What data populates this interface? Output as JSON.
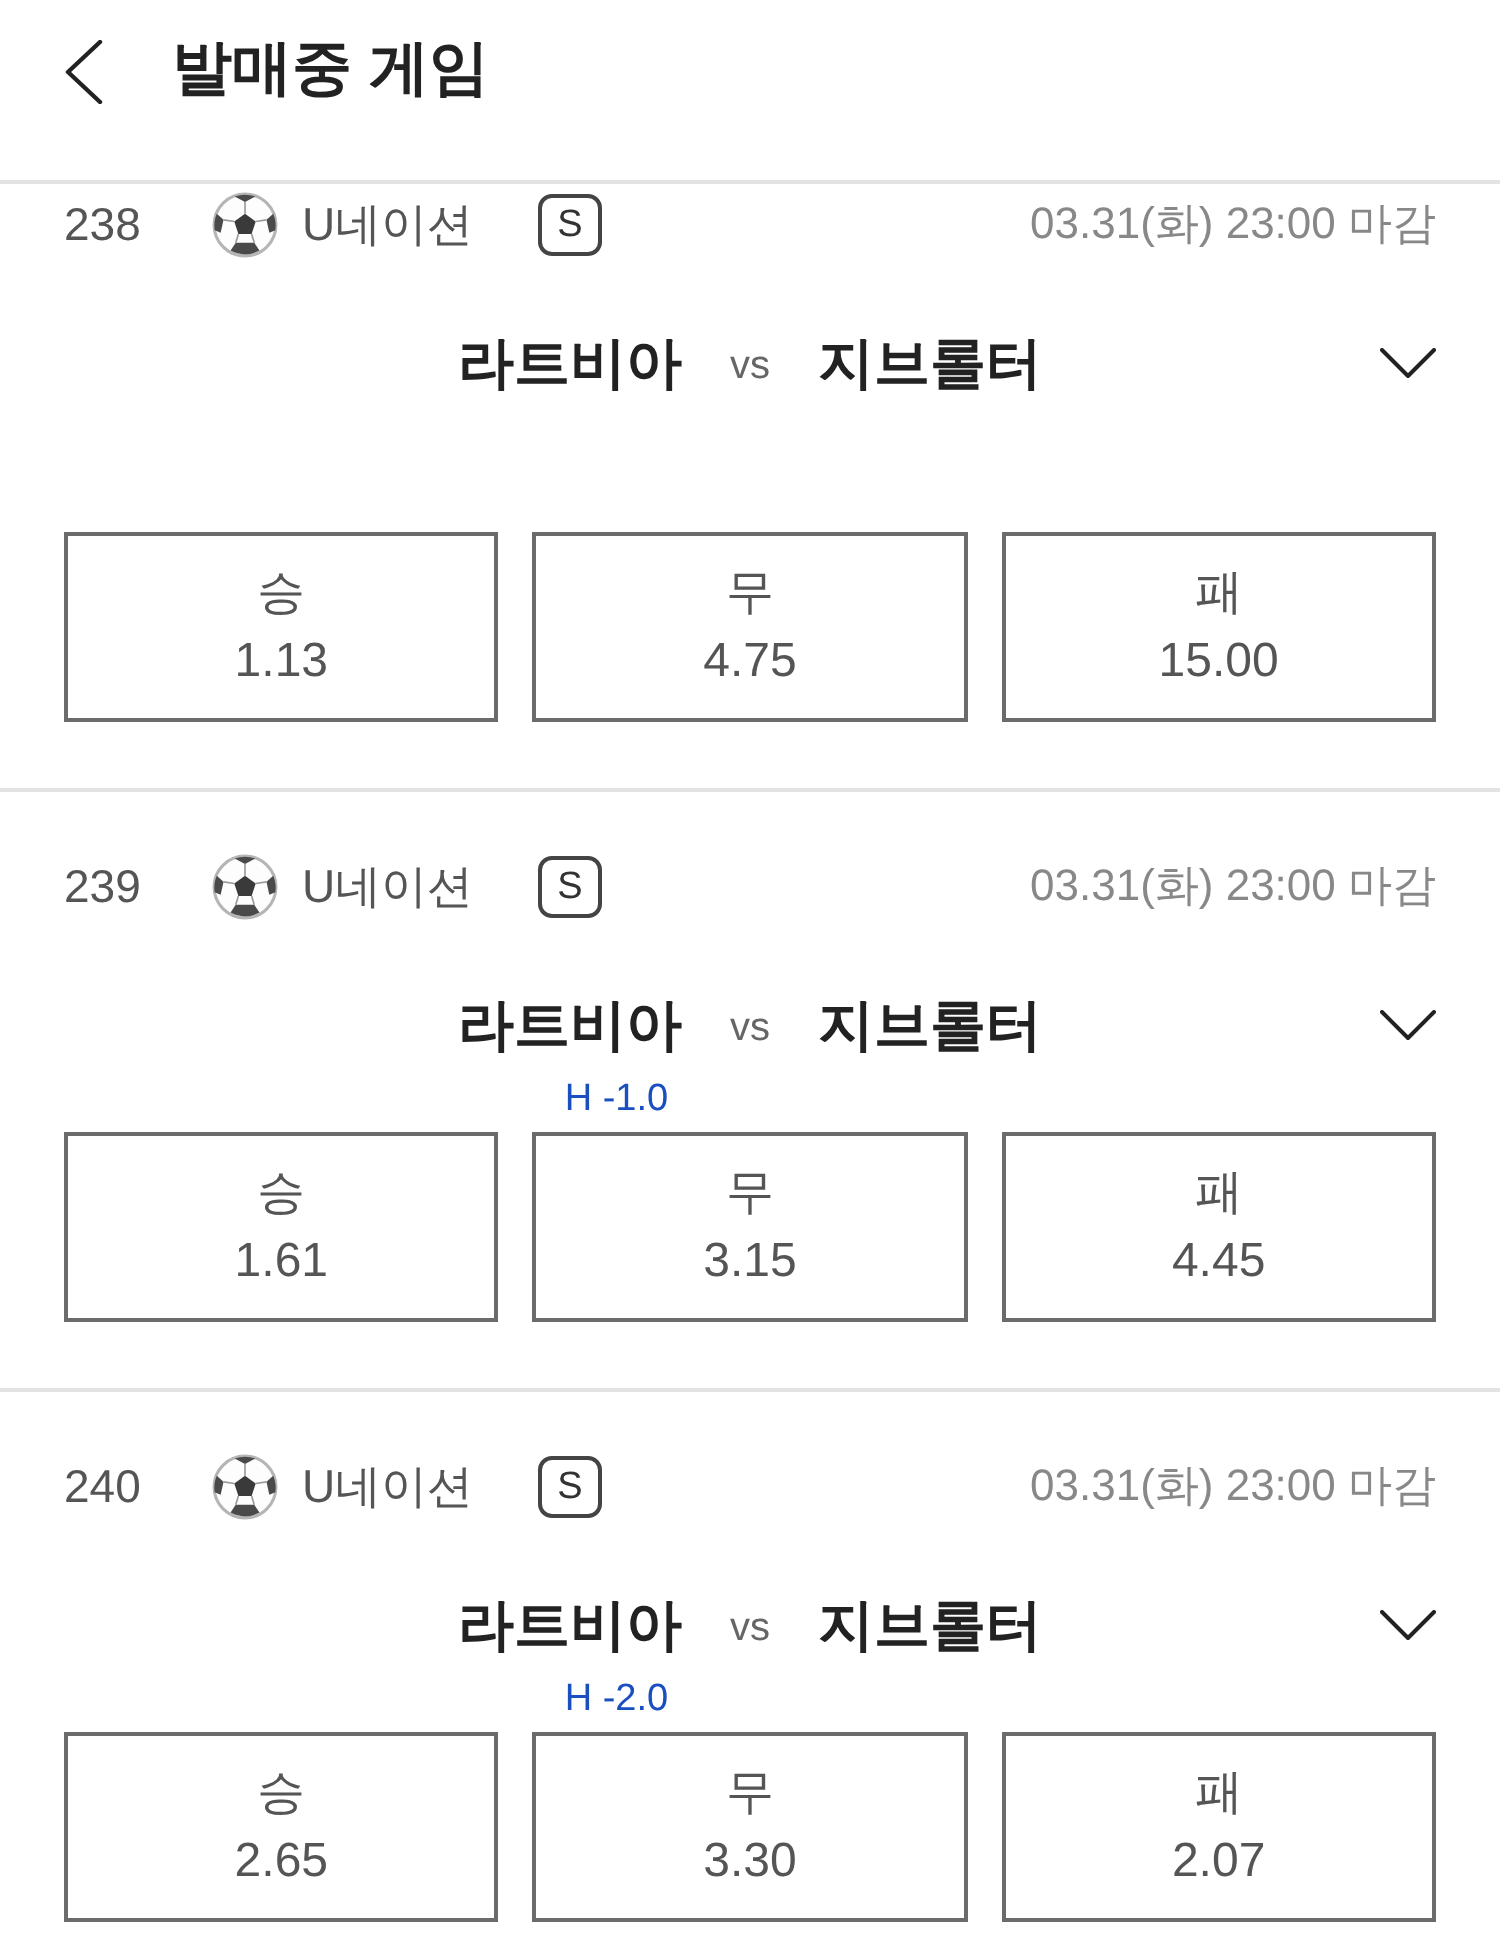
{
  "header": {
    "title": "발매중 게임"
  },
  "games": [
    {
      "number": "238",
      "league": "U네이션",
      "badge": "S",
      "deadline": "03.31(화) 23:00 마감",
      "home": "라트비아",
      "vs": "vs",
      "away": "지브롤터",
      "expanded": false,
      "odds": [
        {
          "label": "승",
          "value": "1.13",
          "selected": false
        },
        {
          "label": "무",
          "value": "4.75",
          "selected": false
        },
        {
          "label": "패",
          "value": "15.00",
          "selected": false
        }
      ]
    },
    {
      "number": "239",
      "league": "U네이션",
      "badge": "S",
      "deadline": "03.31(화) 23:00 마감",
      "home": "라트비아",
      "vs": "vs",
      "away": "지브롤터",
      "expanded": false,
      "handicap": "H -1.0",
      "odds": [
        {
          "label": "승",
          "value": "1.61",
          "selected": false
        },
        {
          "label": "무",
          "value": "3.15",
          "selected": false
        },
        {
          "label": "패",
          "value": "4.45",
          "selected": false
        }
      ]
    },
    {
      "number": "240",
      "league": "U네이션",
      "badge": "S",
      "deadline": "03.31(화) 23:00 마감",
      "home": "라트비아",
      "vs": "vs",
      "away": "지브롤터",
      "expanded": false,
      "handicap": "H -2.0",
      "odds": [
        {
          "label": "승",
          "value": "2.65",
          "selected": false
        },
        {
          "label": "무",
          "value": "3.30",
          "selected": false
        },
        {
          "label": "패",
          "value": "2.07",
          "selected": false
        }
      ]
    }
  ]
}
